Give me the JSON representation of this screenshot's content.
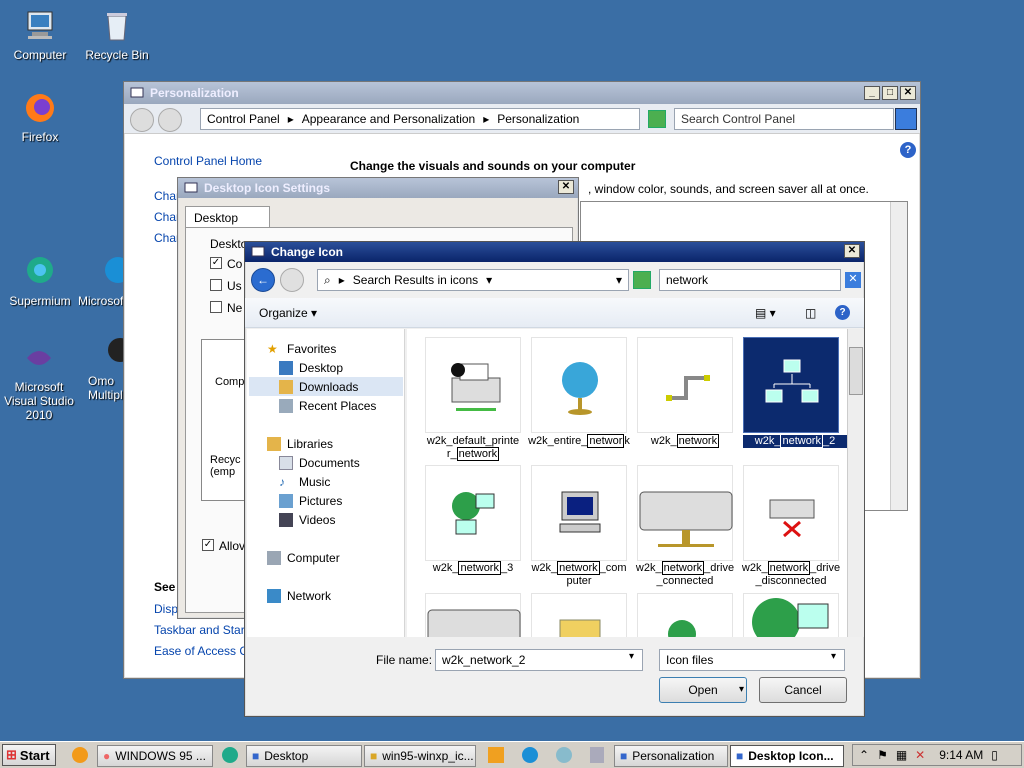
{
  "desktop": {
    "icons": [
      {
        "label": "Computer",
        "icon": "computer-icon"
      },
      {
        "label": "Recycle Bin",
        "icon": "recycle-bin-icon"
      },
      {
        "label": "Firefox",
        "icon": "firefox-icon"
      },
      {
        "label": "Supermium",
        "icon": "supermium-icon"
      },
      {
        "label": "Microsoft Visual Studio 2010",
        "icon": "visual-studio-icon"
      },
      {
        "label": "Microsof",
        "icon": "edge-icon"
      },
      {
        "label": "Omo Multipla",
        "icon": "omo-icon"
      }
    ]
  },
  "personalization": {
    "title": "Personalization",
    "breadcrumb": [
      "Control Panel",
      "Appearance and Personalization",
      "Personalization"
    ],
    "search_placeholder": "Search Control Panel",
    "home_link": "Control Panel Home",
    "heading": "Change the visuals and sounds on your computer",
    "description_tail": ", window color, sounds, and screen saver all at once.",
    "side_links": [
      "Char",
      "Char",
      "Char"
    ],
    "see_also": "See",
    "see_links": [
      "Displ",
      "Taskbar and Start",
      "Ease of Access Ce"
    ]
  },
  "desktop_icon_settings": {
    "title": "Desktop Icon Settings",
    "tab": "Desktop Icons",
    "group_label": "Deskto",
    "checkboxes": [
      {
        "label": "Co",
        "checked": true
      },
      {
        "label": "Us",
        "checked": false
      },
      {
        "label": "Ne",
        "checked": false
      }
    ],
    "preview_items": [
      "Comp",
      "Recyc (emp"
    ],
    "allow_label": "Allov"
  },
  "change_icon": {
    "title": "Change Icon",
    "address": "Search Results in icons",
    "search_value": "network",
    "organize": "Organize",
    "nav": {
      "favorites": "Favorites",
      "favorites_items": [
        "Desktop",
        "Downloads",
        "Recent Places"
      ],
      "libraries": "Libraries",
      "libraries_items": [
        "Documents",
        "Music",
        "Pictures",
        "Videos"
      ],
      "computer": "Computer",
      "network": "Network"
    },
    "files": [
      {
        "pre": "w2k_default_printe r_",
        "match": "network",
        "post": ""
      },
      {
        "pre": "w2k_entire_",
        "match": "networ",
        "post": "k"
      },
      {
        "pre": "w2k_",
        "match": "network",
        "post": ""
      },
      {
        "pre": "w2k_",
        "match": "network",
        "post": "_2"
      },
      {
        "pre": "w2k_",
        "match": "network",
        "post": "_3"
      },
      {
        "pre": "w2k_",
        "match": "network",
        "post": "_com puter"
      },
      {
        "pre": "w2k_",
        "match": "network",
        "post": "_drive _connected"
      },
      {
        "pre": "w2k_",
        "match": "network",
        "post": "_drive _disconnected"
      }
    ],
    "file_name_label": "File name:",
    "file_name_value": "w2k_network_2",
    "file_type": "Icon files",
    "open_label": "Open",
    "cancel_label": "Cancel"
  },
  "taskbar": {
    "start": "Start",
    "items": [
      "WINDOWS 95 ...",
      "Desktop",
      "win95-winxp_ic...",
      "Personalization",
      "Desktop Icon..."
    ],
    "clock": "9:14 AM"
  }
}
